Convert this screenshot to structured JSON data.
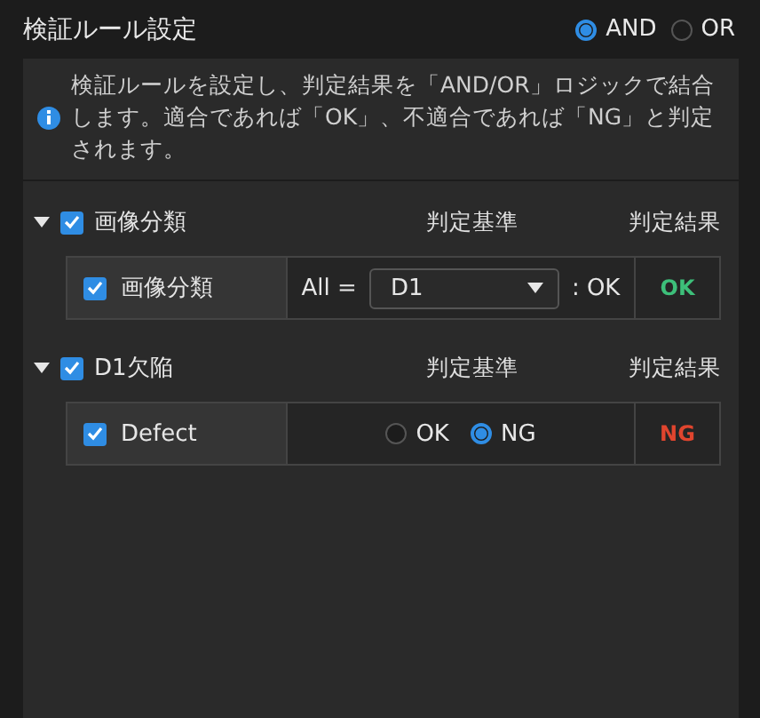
{
  "header": {
    "title": "検証ルール設定",
    "logic_options": [
      {
        "label": "AND",
        "selected": true
      },
      {
        "label": "OR",
        "selected": false
      }
    ]
  },
  "info": {
    "text": "検証ルールを設定し、判定結果を「AND/OR」ロジックで結合します。適合であれば「OK」、不適合であれば「NG」と判定されます。"
  },
  "groups": [
    {
      "name": "画像分類",
      "checked": true,
      "expanded": true,
      "criteria_header": "判定基準",
      "result_header": "判定結果",
      "rows": [
        {
          "kind": "dropdown",
          "name": "画像分類",
          "checked": true,
          "prefix": "All =",
          "value": "D1",
          "suffix": ": OK",
          "result": "OK",
          "color": "#3dbf7a"
        }
      ]
    },
    {
      "name": "D1欠陥",
      "checked": true,
      "expanded": true,
      "criteria_header": "判定基準",
      "result_header": "判定結果",
      "rows": [
        {
          "kind": "radio",
          "name": "Defect",
          "checked": true,
          "options": [
            {
              "label": "OK",
              "selected": false
            },
            {
              "label": "NG",
              "selected": true
            }
          ],
          "result": "NG",
          "color": "#e0452e"
        }
      ]
    }
  ]
}
